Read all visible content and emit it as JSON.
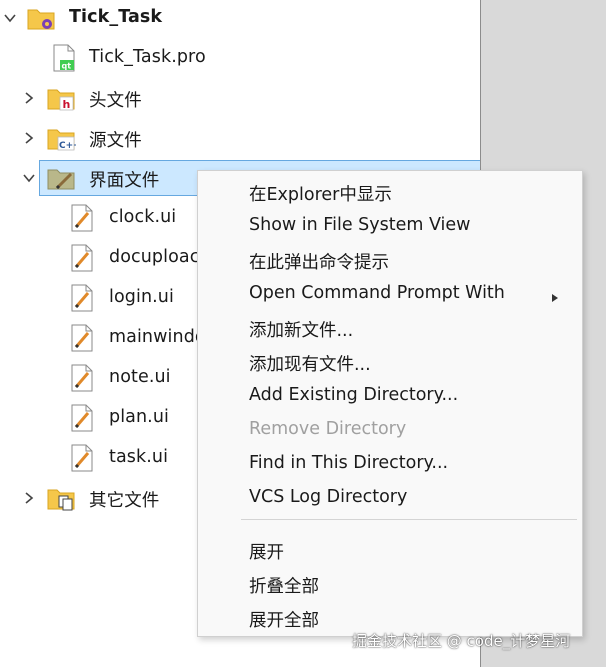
{
  "tree": {
    "project": {
      "label": "Tick_Task",
      "expanded": true
    },
    "items": [
      {
        "label": "Tick_Task.pro",
        "icon": "qt-project-file-icon"
      },
      {
        "label": "头文件",
        "icon": "header-folder-icon",
        "expanded": false
      },
      {
        "label": "源文件",
        "icon": "source-folder-icon",
        "expanded": false
      },
      {
        "label": "界面文件",
        "icon": "forms-folder-icon",
        "expanded": true,
        "selected": true
      },
      {
        "label": "clock.ui",
        "icon": "ui-file-icon"
      },
      {
        "label": "docuploac",
        "icon": "ui-file-icon"
      },
      {
        "label": "login.ui",
        "icon": "ui-file-icon"
      },
      {
        "label": "mainwindo",
        "icon": "ui-file-icon"
      },
      {
        "label": "note.ui",
        "icon": "ui-file-icon"
      },
      {
        "label": "plan.ui",
        "icon": "ui-file-icon"
      },
      {
        "label": "task.ui",
        "icon": "ui-file-icon"
      },
      {
        "label": "其它文件",
        "icon": "other-folder-icon",
        "expanded": false
      }
    ]
  },
  "context_menu": {
    "items": [
      {
        "label": "在Explorer中显示",
        "enabled": true
      },
      {
        "label": "Show in File System View",
        "enabled": true
      },
      {
        "label": "在此弹出命令提示",
        "enabled": true
      },
      {
        "label": "Open Command Prompt With",
        "enabled": true,
        "submenu": true
      },
      {
        "label": "添加新文件...",
        "enabled": true
      },
      {
        "label": "添加现有文件...",
        "enabled": true
      },
      {
        "label": "Add Existing Directory...",
        "enabled": true
      },
      {
        "label": "Remove Directory",
        "enabled": false
      },
      {
        "label": "Find in This Directory...",
        "enabled": true
      },
      {
        "label": "VCS Log Directory",
        "enabled": true
      },
      {
        "label": "展开",
        "enabled": true
      },
      {
        "label": "折叠全部",
        "enabled": true
      },
      {
        "label": "展开全部",
        "enabled": true
      }
    ]
  },
  "watermark": "掘金技术社区 @ code_计梦星河",
  "colors": {
    "selection_bg": "#cce8ff",
    "selection_border": "#66a8e0",
    "folder_yellow": "#f5c74a",
    "right_pane": "#d9d9d9",
    "disabled_text": "#a0a0a0"
  }
}
